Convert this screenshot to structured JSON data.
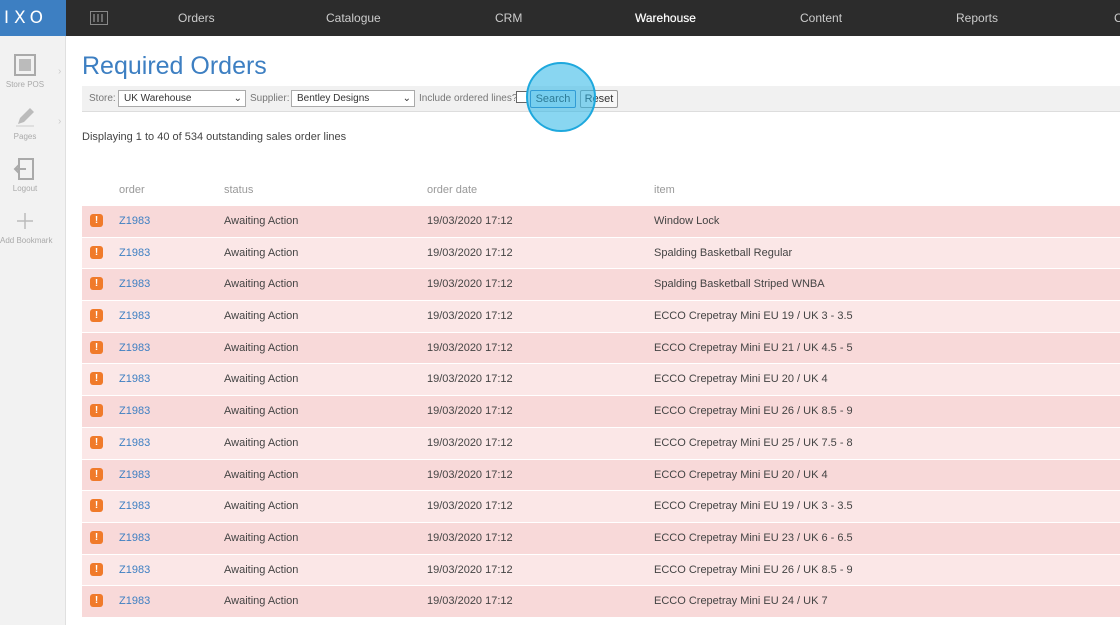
{
  "app": {
    "logo": "IXO"
  },
  "nav": [
    "Orders",
    "Catalogue",
    "CRM",
    "Warehouse",
    "Content",
    "Reports",
    "C"
  ],
  "nav_active": "Warehouse",
  "sidebar": [
    {
      "label": "Store POS",
      "icon": "pos-icon"
    },
    {
      "label": "Pages",
      "icon": "pencil-icon"
    },
    {
      "label": "Logout",
      "icon": "logout-icon"
    },
    {
      "label": "Add Bookmark",
      "icon": "plus-icon"
    }
  ],
  "page": {
    "title": "Required Orders"
  },
  "filters": {
    "store_label": "Store:",
    "store_value": "UK Warehouse",
    "supplier_label": "Supplier:",
    "supplier_value": "Bentley Designs",
    "include_label": "Include ordered lines?",
    "search_label": "Search",
    "reset_label": "Reset"
  },
  "summary": "Displaying 1 to 40 of 534 outstanding sales order lines",
  "table": {
    "headers": [
      "order",
      "status",
      "order date",
      "item"
    ],
    "rows": [
      {
        "order": "Z1983",
        "status": "Awaiting Action",
        "date": "19/03/2020 17:12",
        "item": "Window Lock"
      },
      {
        "order": "Z1983",
        "status": "Awaiting Action",
        "date": "19/03/2020 17:12",
        "item": "Spalding Basketball Regular"
      },
      {
        "order": "Z1983",
        "status": "Awaiting Action",
        "date": "19/03/2020 17:12",
        "item": "Spalding Basketball Striped WNBA"
      },
      {
        "order": "Z1983",
        "status": "Awaiting Action",
        "date": "19/03/2020 17:12",
        "item": "ECCO Crepetray Mini EU 19 / UK 3 - 3.5"
      },
      {
        "order": "Z1983",
        "status": "Awaiting Action",
        "date": "19/03/2020 17:12",
        "item": "ECCO Crepetray Mini EU 21 / UK 4.5 - 5"
      },
      {
        "order": "Z1983",
        "status": "Awaiting Action",
        "date": "19/03/2020 17:12",
        "item": "ECCO Crepetray Mini EU 20 / UK 4"
      },
      {
        "order": "Z1983",
        "status": "Awaiting Action",
        "date": "19/03/2020 17:12",
        "item": "ECCO Crepetray Mini EU 26 / UK 8.5 - 9"
      },
      {
        "order": "Z1983",
        "status": "Awaiting Action",
        "date": "19/03/2020 17:12",
        "item": "ECCO Crepetray Mini EU 25 / UK 7.5 - 8"
      },
      {
        "order": "Z1983",
        "status": "Awaiting Action",
        "date": "19/03/2020 17:12",
        "item": "ECCO Crepetray Mini EU 20 / UK 4"
      },
      {
        "order": "Z1983",
        "status": "Awaiting Action",
        "date": "19/03/2020 17:12",
        "item": "ECCO Crepetray Mini EU 19 / UK 3 - 3.5"
      },
      {
        "order": "Z1983",
        "status": "Awaiting Action",
        "date": "19/03/2020 17:12",
        "item": "ECCO Crepetray Mini EU 23 / UK 6 - 6.5"
      },
      {
        "order": "Z1983",
        "status": "Awaiting Action",
        "date": "19/03/2020 17:12",
        "item": "ECCO Crepetray Mini EU 26 / UK 8.5 - 9"
      },
      {
        "order": "Z1983",
        "status": "Awaiting Action",
        "date": "19/03/2020 17:12",
        "item": "ECCO Crepetray Mini EU 24 / UK 7"
      }
    ]
  },
  "colors": {
    "accent": "#3d7fc2",
    "alert": "#f07a2a",
    "row_tint": "#f8d9d9",
    "topbar": "#2c2c2c"
  }
}
